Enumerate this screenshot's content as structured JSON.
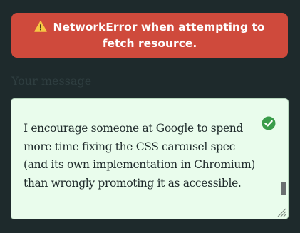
{
  "error": {
    "icon": "warning-icon",
    "message": "NetworkError when attempting to fetch resource.",
    "background": "#cf4a3c"
  },
  "form": {
    "message_label": "Your message",
    "message_value": "I encourage someone at Google to spend more time fixing the CSS carousel spec (and its own implementation in Chromium) than wrongly promoting it as accessible.",
    "valid_icon": "check-circle-icon",
    "valid_color": "#3a9c4a",
    "field_background": "#e9fcec"
  }
}
